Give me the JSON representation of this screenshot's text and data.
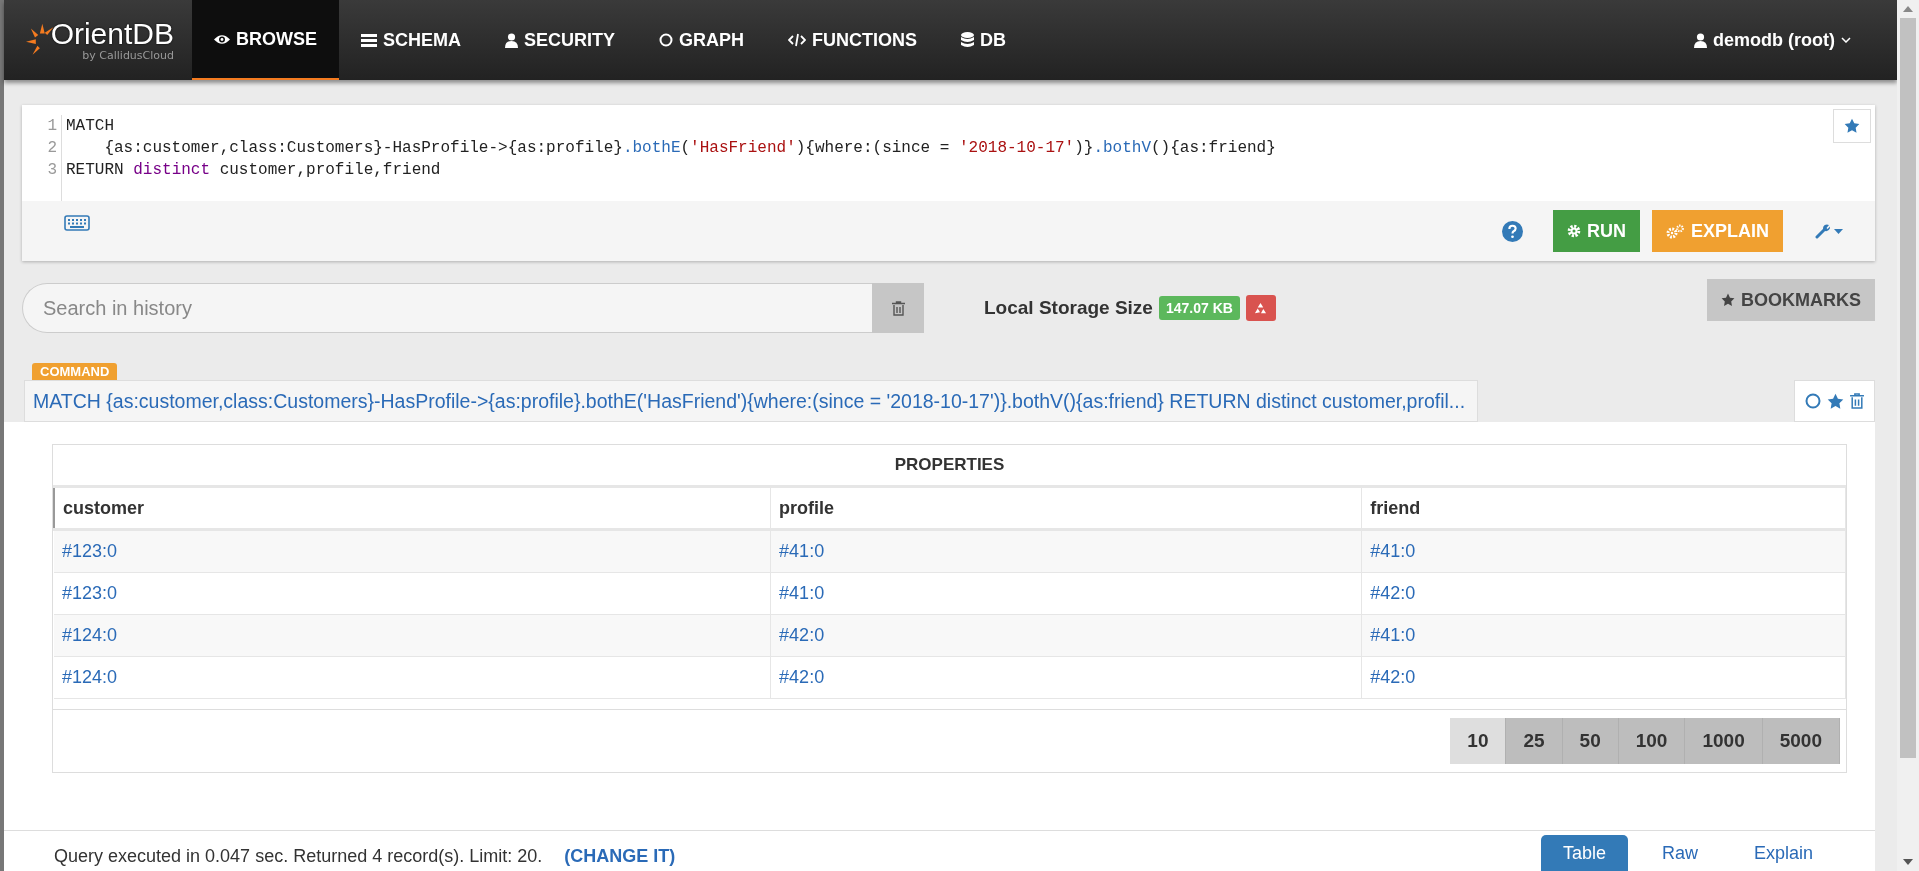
{
  "brand": {
    "name": "OrientDB",
    "tagline": "by CallidusCloud"
  },
  "nav": [
    {
      "label": "BROWSE",
      "kind": "browse",
      "selected": true
    },
    {
      "label": "SCHEMA",
      "kind": "schema",
      "selected": false
    },
    {
      "label": "SECURITY",
      "kind": "security",
      "selected": false
    },
    {
      "label": "GRAPH",
      "kind": "graph",
      "selected": false
    },
    {
      "label": "FUNCTIONS",
      "kind": "functions",
      "selected": false
    },
    {
      "label": "DB",
      "kind": "db",
      "selected": false
    }
  ],
  "user_menu": {
    "label": "demodb (root)"
  },
  "editor": {
    "lines": [
      {
        "number": "1",
        "tokens": [
          {
            "kind": "plain",
            "text": "MATCH"
          }
        ]
      },
      {
        "number": "2",
        "tokens": [
          {
            "kind": "plain",
            "text": "    {as:customer,class:Customers}-HasProfile->{as:profile}"
          },
          {
            "kind": "func",
            "text": ".bothE"
          },
          {
            "kind": "plain",
            "text": "("
          },
          {
            "kind": "string",
            "text": "'HasFriend'"
          },
          {
            "kind": "plain",
            "text": "){where:(since = "
          },
          {
            "kind": "string",
            "text": "'2018-10-17'"
          },
          {
            "kind": "plain",
            "text": ")}"
          },
          {
            "kind": "func",
            "text": ".bothV"
          },
          {
            "kind": "plain",
            "text": "(){as:friend}"
          }
        ]
      },
      {
        "number": "3",
        "tokens": [
          {
            "kind": "plain",
            "text": "RETURN "
          },
          {
            "kind": "keyword",
            "text": "distinct"
          },
          {
            "kind": "plain",
            "text": " customer,profile,friend"
          }
        ]
      }
    ]
  },
  "toolbar": {
    "run": "RUN",
    "explain": "EXPLAIN"
  },
  "history_search": {
    "placeholder": "Search in history"
  },
  "storage": {
    "label": "Local Storage Size",
    "size": "147.07 KB"
  },
  "bookmarks_button": "BOOKMARKS",
  "result": {
    "badge": "COMMAND",
    "command": "MATCH {as:customer,class:Customers}-HasProfile->{as:profile}.bothE('HasFriend'){where:(since = '2018-10-17')}.bothV(){as:friend} RETURN distinct customer,profil...",
    "table": {
      "title": "PROPERTIES",
      "columns": [
        "customer",
        "profile",
        "friend"
      ],
      "rows": [
        [
          "#123:0",
          "#41:0",
          "#41:0"
        ],
        [
          "#123:0",
          "#41:0",
          "#42:0"
        ],
        [
          "#124:0",
          "#42:0",
          "#41:0"
        ],
        [
          "#124:0",
          "#42:0",
          "#42:0"
        ]
      ]
    },
    "page_sizes": [
      {
        "label": "10",
        "selected": true
      },
      {
        "label": "25",
        "selected": false
      },
      {
        "label": "50",
        "selected": false
      },
      {
        "label": "100",
        "selected": false
      },
      {
        "label": "1000",
        "selected": false
      },
      {
        "label": "5000",
        "selected": false
      }
    ],
    "status": "Query executed in 0.047 sec. Returned 4 record(s). Limit: 20.",
    "change_link": "(CHANGE IT)",
    "view_tabs": [
      {
        "label": "Table",
        "selected": true
      },
      {
        "label": "Raw",
        "selected": false
      },
      {
        "label": "Explain",
        "selected": false
      }
    ]
  }
}
